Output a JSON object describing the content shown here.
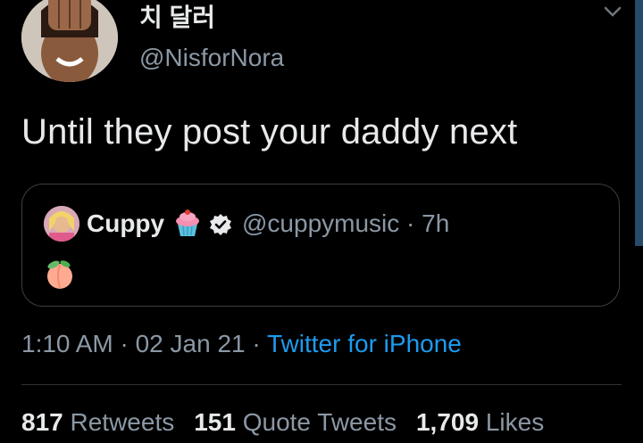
{
  "tweet": {
    "display_name": "치 달러",
    "handle": "@NisforNora",
    "text": "Until they post your daddy next",
    "quoted": {
      "name": "Cuppy",
      "handle_time": "@cuppymusic · 7h",
      "emoji_content": "peach-emoji"
    },
    "timestamp": "1:10 AM · 02 Jan 21 · ",
    "source": "Twitter for iPhone",
    "stats": {
      "retweets_count": "817",
      "retweets_label": "Retweets",
      "quotes_count": "151",
      "quotes_label": "Quote Tweets",
      "likes_count": "1,709",
      "likes_label": "Likes"
    }
  },
  "colors": {
    "background": "#000000",
    "text": "#e7e9ea",
    "muted": "#8b98a5",
    "link": "#1d9bf0",
    "border": "#3a3f44"
  },
  "icons": [
    "chevron-down-icon",
    "cupcake-emoji",
    "verified-badge-icon",
    "peach-emoji"
  ]
}
